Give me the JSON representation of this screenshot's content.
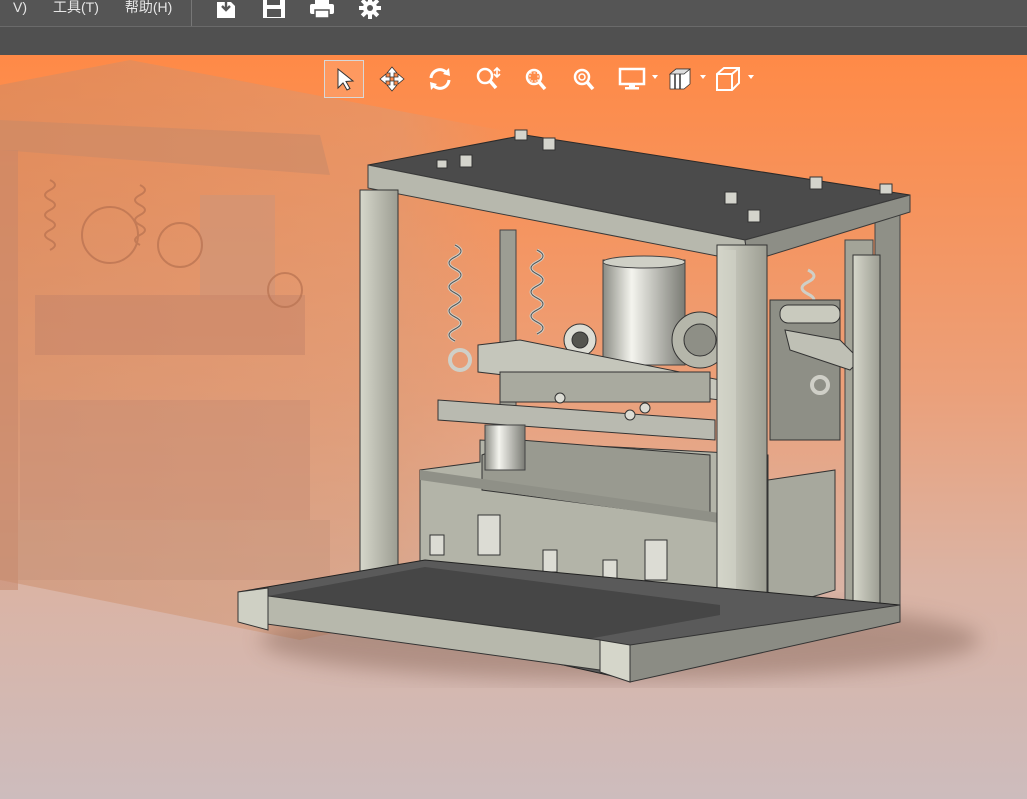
{
  "menubar": {
    "items": [
      {
        "label": "V)"
      },
      {
        "label": "工具(T)"
      },
      {
        "label": "帮助(H)"
      }
    ],
    "quick_tools": [
      {
        "icon": "import-icon"
      },
      {
        "icon": "save-icon"
      },
      {
        "icon": "print-icon"
      },
      {
        "icon": "gear-icon"
      }
    ]
  },
  "view_toolbar": {
    "tools": [
      {
        "icon": "select-arrow-icon",
        "active": true
      },
      {
        "icon": "pan-move-icon"
      },
      {
        "icon": "rotate-icon"
      },
      {
        "icon": "zoom-dynamic-icon"
      },
      {
        "icon": "zoom-window-icon"
      },
      {
        "icon": "zoom-fit-icon"
      },
      {
        "icon": "display-mode-icon",
        "dropdown": true
      },
      {
        "icon": "section-view-icon",
        "dropdown": true
      },
      {
        "icon": "view-orientation-cube-icon",
        "dropdown": true
      }
    ]
  },
  "colors": {
    "menubar_bg": "#555555",
    "viewport_top": "#ff8a47",
    "viewport_bottom": "#cdbcbd",
    "model_light": "#b3b4a7",
    "model_dark": "#4e4e4e"
  }
}
